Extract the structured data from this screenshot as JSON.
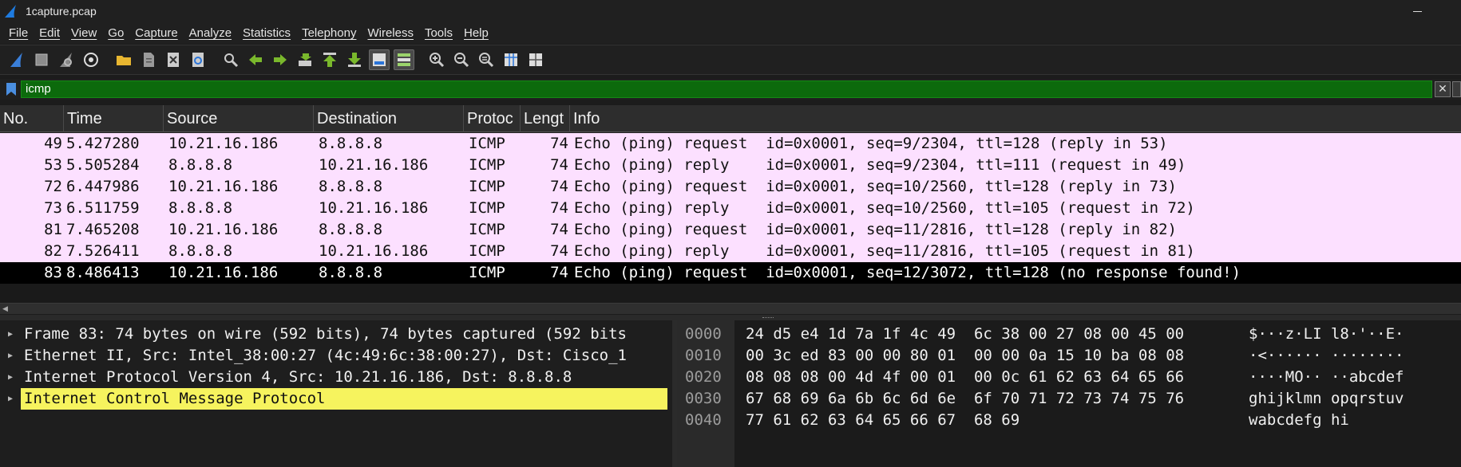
{
  "window": {
    "title": "1capture.pcap"
  },
  "menu": [
    "File",
    "Edit",
    "View",
    "Go",
    "Capture",
    "Analyze",
    "Statistics",
    "Telephony",
    "Wireless",
    "Tools",
    "Help"
  ],
  "toolbar": {
    "icons": [
      "start-capture-icon",
      "stop-capture-icon",
      "restart-capture-icon",
      "capture-options-icon",
      "open-file-icon",
      "save-file-icon",
      "close-file-icon",
      "reload-file-icon",
      "find-packet-icon",
      "go-back-icon",
      "go-forward-icon",
      "go-to-packet-icon",
      "go-first-icon",
      "go-last-icon",
      "autoscroll-icon",
      "colorize-icon",
      "zoom-in-icon",
      "zoom-out-icon",
      "zoom-normal-icon",
      "resize-columns-icon",
      "layout-icon"
    ]
  },
  "filter": {
    "value": "icmp",
    "color": "#0c6a0c"
  },
  "columns": [
    "No.",
    "Time",
    "Source",
    "Destination",
    "Protoc",
    "Lengt",
    "Info"
  ],
  "packets": [
    {
      "no": "49",
      "time": "5.427280",
      "src": "10.21.16.186",
      "dst": "8.8.8.8",
      "proto": "ICMP",
      "len": "74",
      "info": "Echo (ping) request  id=0x0001, seq=9/2304, ttl=128 (reply in 53)"
    },
    {
      "no": "53",
      "time": "5.505284",
      "src": "8.8.8.8",
      "dst": "10.21.16.186",
      "proto": "ICMP",
      "len": "74",
      "info": "Echo (ping) reply    id=0x0001, seq=9/2304, ttl=111 (request in 49)"
    },
    {
      "no": "72",
      "time": "6.447986",
      "src": "10.21.16.186",
      "dst": "8.8.8.8",
      "proto": "ICMP",
      "len": "74",
      "info": "Echo (ping) request  id=0x0001, seq=10/2560, ttl=128 (reply in 73)"
    },
    {
      "no": "73",
      "time": "6.511759",
      "src": "8.8.8.8",
      "dst": "10.21.16.186",
      "proto": "ICMP",
      "len": "74",
      "info": "Echo (ping) reply    id=0x0001, seq=10/2560, ttl=105 (request in 72)"
    },
    {
      "no": "81",
      "time": "7.465208",
      "src": "10.21.16.186",
      "dst": "8.8.8.8",
      "proto": "ICMP",
      "len": "74",
      "info": "Echo (ping) request  id=0x0001, seq=11/2816, ttl=128 (reply in 82)"
    },
    {
      "no": "82",
      "time": "7.526411",
      "src": "8.8.8.8",
      "dst": "10.21.16.186",
      "proto": "ICMP",
      "len": "74",
      "info": "Echo (ping) reply    id=0x0001, seq=11/2816, ttl=105 (request in 81)"
    },
    {
      "no": "83",
      "time": "8.486413",
      "src": "10.21.16.186",
      "dst": "8.8.8.8",
      "proto": "ICMP",
      "len": "74",
      "info": "Echo (ping) request  id=0x0001, seq=12/3072, ttl=128 (no response found!)"
    }
  ],
  "colors": {
    "row_ping": "#fce0ff",
    "row_selected": "#000000",
    "detail_highlight": "#f6f35e"
  },
  "details": [
    "Frame 83: 74 bytes on wire (592 bits), 74 bytes captured (592 bits",
    "Ethernet II, Src: Intel_38:00:27 (4c:49:6c:38:00:27), Dst: Cisco_1",
    "Internet Protocol Version 4, Src: 10.21.16.186, Dst: 8.8.8.8",
    "Internet Control Message Protocol"
  ],
  "bytes": [
    {
      "offset": "0000",
      "hex": "24 d5 e4 1d 7a 1f 4c 49  6c 38 00 27 08 00 45 00",
      "ascii": "$···z·LI l8·'··E·"
    },
    {
      "offset": "0010",
      "hex": "00 3c ed 83 00 00 80 01  00 00 0a 15 10 ba 08 08",
      "ascii": "·<······ ········"
    },
    {
      "offset": "0020",
      "hex": "08 08 08 00 4d 4f 00 01  00 0c 61 62 63 64 65 66",
      "ascii": "····MO·· ··abcdef"
    },
    {
      "offset": "0030",
      "hex": "67 68 69 6a 6b 6c 6d 6e  6f 70 71 72 73 74 75 76",
      "ascii": "ghijklmn opqrstuv"
    },
    {
      "offset": "0040",
      "hex": "77 61 62 63 64 65 66 67  68 69",
      "ascii": "wabcdefg hi"
    }
  ]
}
